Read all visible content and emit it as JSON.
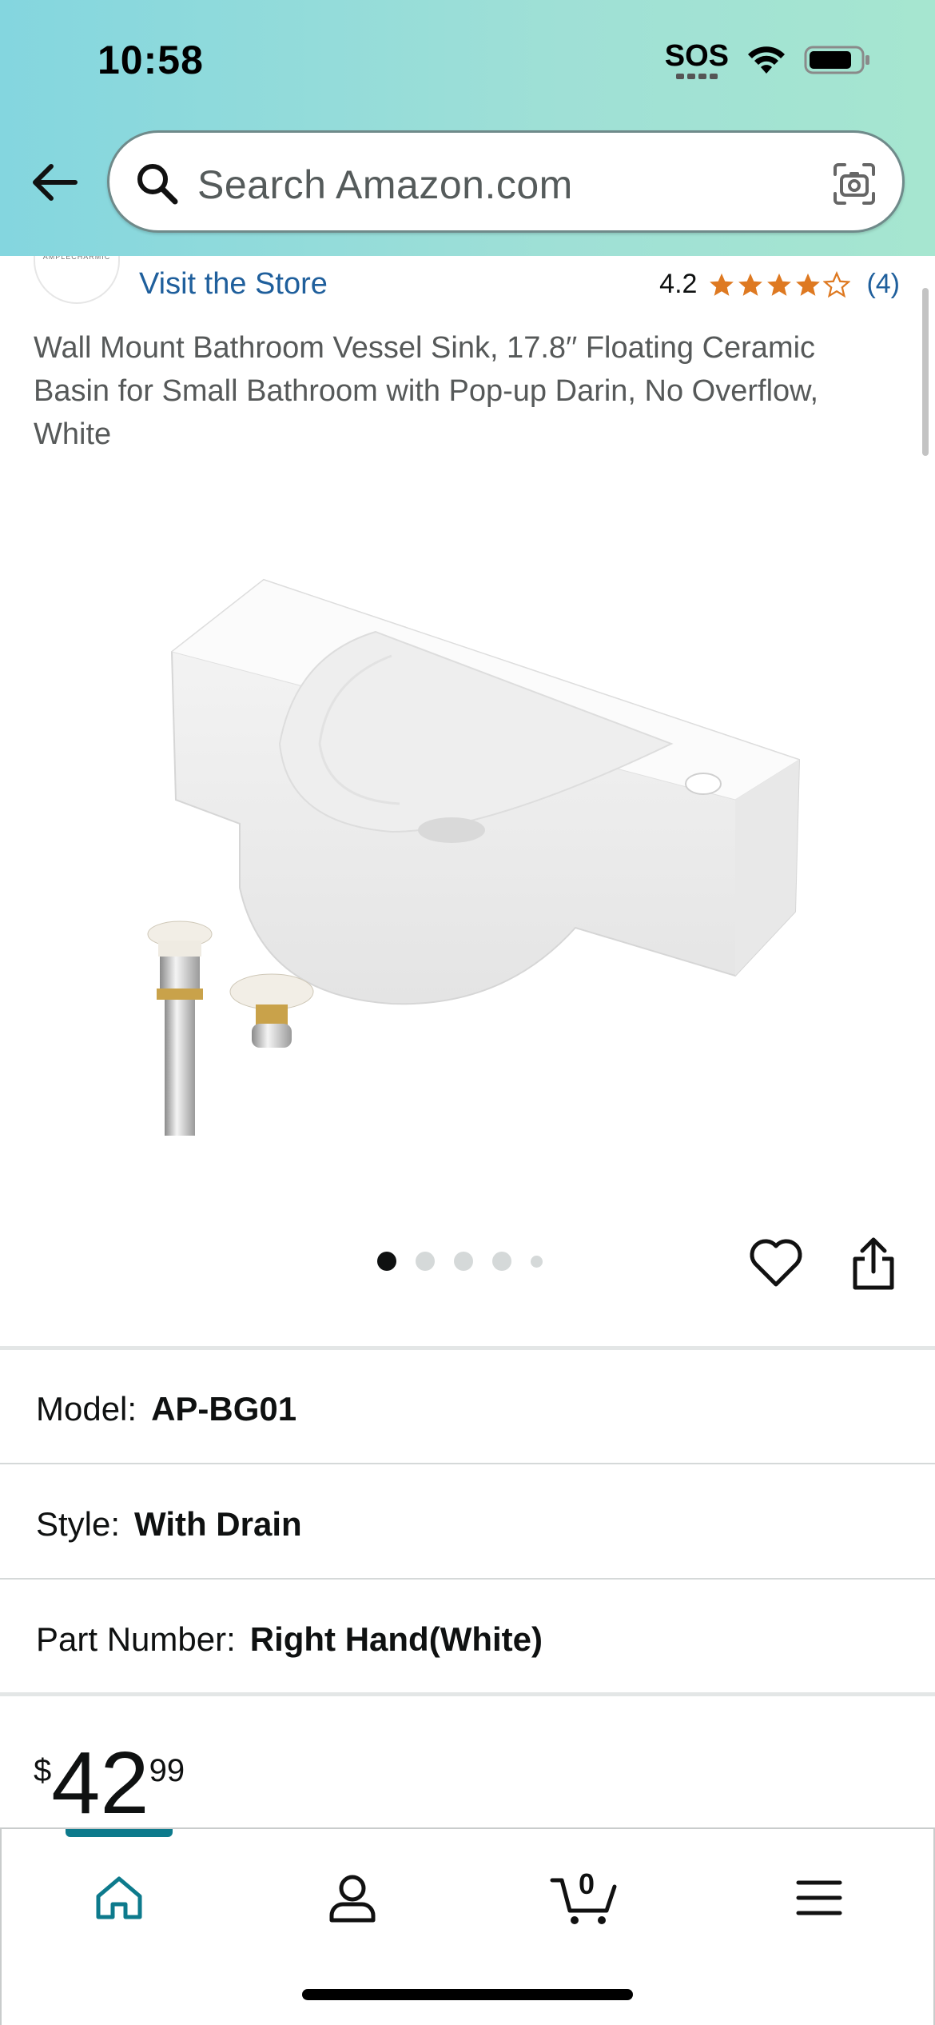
{
  "status_bar": {
    "time": "10:58",
    "sos_label": "SOS",
    "icons": [
      "wifi-icon",
      "battery-icon"
    ]
  },
  "search": {
    "placeholder": "Search Amazon.com",
    "icons": [
      "back-arrow-icon",
      "search-icon",
      "camera-icon"
    ]
  },
  "store": {
    "logo_text": "AMPLECHARMIC",
    "visit_label": "Visit the Store",
    "rating_value": "4.2",
    "rating_stars": 4.2,
    "rating_count": "(4)"
  },
  "product": {
    "title": "Wall Mount Bathroom Vessel Sink, 17.8′′ Floating Ceramic Basin for Small Bathroom with Pop-up Darin, No Overflow, White",
    "image_pager": {
      "count": 5,
      "active_index": 0
    },
    "actions": [
      "heart-icon",
      "share-icon"
    ]
  },
  "variations": [
    {
      "label": "Model:",
      "value": "AP-BG01"
    },
    {
      "label": "Style:",
      "value": "With Drain"
    },
    {
      "label": "Part Number:",
      "value": "Right Hand(White)"
    }
  ],
  "price": {
    "symbol": "$",
    "whole": "42",
    "fraction": "99"
  },
  "tabbar": {
    "tabs": [
      "home-icon",
      "account-icon",
      "cart-icon",
      "menu-icon"
    ],
    "cart_count": "0",
    "active_tab": "home",
    "accent_color": "#0d7a8c"
  },
  "colors": {
    "link": "#1f5f9c",
    "star": "#de7921",
    "header_gradient_start": "#84d6df",
    "header_gradient_end": "#a6e6d0"
  }
}
